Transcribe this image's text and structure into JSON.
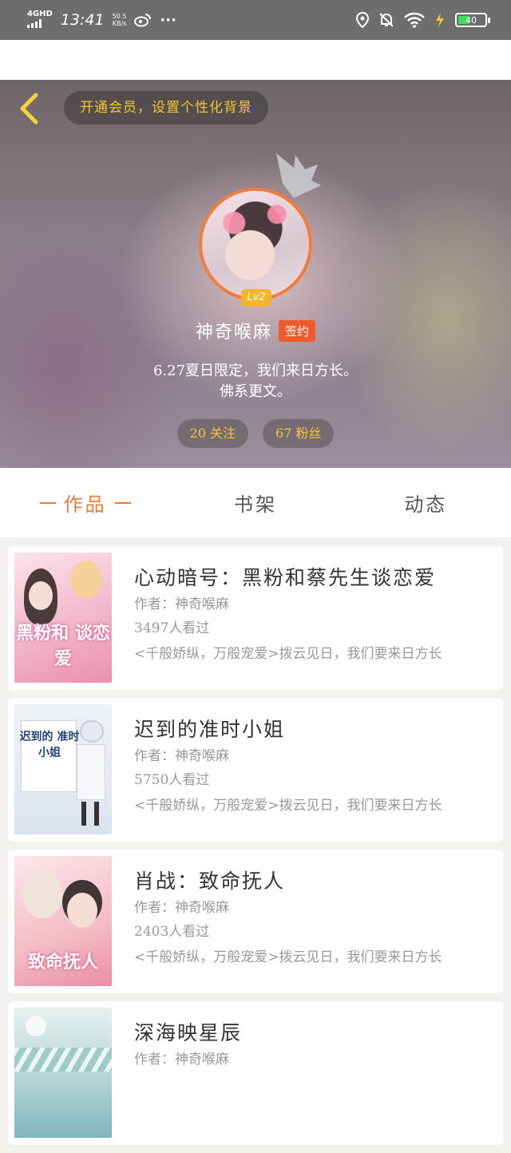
{
  "status_bar": {
    "network": "4GHD",
    "time": "13:41",
    "speed_value": "50.5",
    "speed_unit": "KB/s",
    "more": "···",
    "battery": "40"
  },
  "header": {
    "vip_prompt": "开通会员，设置个性化背景",
    "level": "Lv2",
    "username": "神奇喉麻",
    "sign_badge": "签约",
    "bio_line1": "6.27夏日限定，我们来日方长。",
    "bio_line2": "佛系更文。",
    "following": "20 关注",
    "fans": "67 粉丝"
  },
  "tabs": [
    {
      "label": "作品"
    },
    {
      "label": "书架"
    },
    {
      "label": "动态"
    }
  ],
  "books": [
    {
      "title": "心动暗号：黑粉和蔡先生谈恋爱",
      "author": "作者：神奇喉麻",
      "views": "3497人看过",
      "desc": "<千般娇纵，万般宠爱>拨云见日，我们要来日方长",
      "cover_text": "黑粉和 谈恋爱",
      "cover_color": "#f4c3d3"
    },
    {
      "title": "迟到的准时小姐",
      "author": "作者：神奇喉麻",
      "views": "5750人看过",
      "desc": "<千般娇纵，万般宠爱>拨云见日，我们要来日方长",
      "cover_text": "迟到的 准时小姐",
      "cover_color": "#dfe7ef"
    },
    {
      "title": "肖战：致命抚人",
      "author": "作者：神奇喉麻",
      "views": "2403人看过",
      "desc": "<千般娇纵，万般宠爱>拨云见日，我们要来日方长",
      "cover_text": "致命抚人",
      "cover_color": "#f6c6cf"
    },
    {
      "title": "深海映星辰",
      "author": "作者：神奇喉麻",
      "views": "",
      "desc": "",
      "cover_text": "",
      "cover_color": "#cfe3e2"
    }
  ]
}
